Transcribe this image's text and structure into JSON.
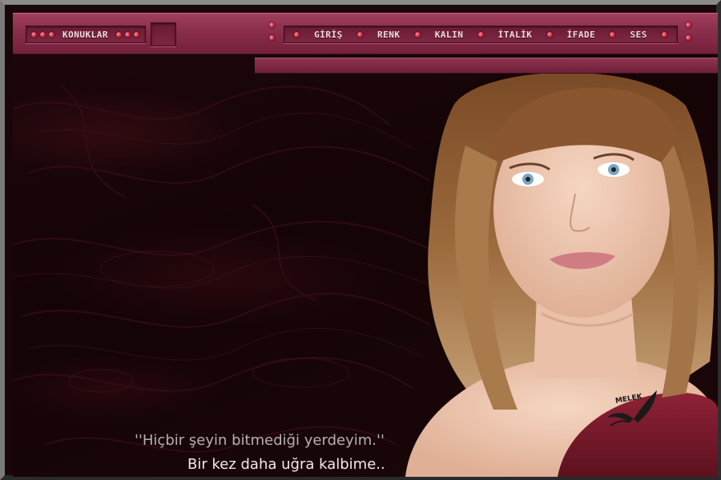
{
  "menu": {
    "topics_label": "KONUKLAR",
    "nav_items": [
      {
        "label": "GİRİŞ"
      },
      {
        "label": "RENK"
      },
      {
        "label": "KALIN"
      },
      {
        "label": "İTALİK"
      },
      {
        "label": "İFADE"
      },
      {
        "label": "SES"
      }
    ]
  },
  "quote": {
    "line1": "''Hiçbir şeyin bitmediği yerdeyim.''",
    "line2": "Bir kez daha uğra kalbime.."
  },
  "signature": "MELEK",
  "colors": {
    "accent": "#8b2f4c",
    "panel": "#6a1b33",
    "background": "#1a0608"
  },
  "icons": {
    "indicator": "red-dot-icon",
    "signature_mark": "angel-wings-icon"
  }
}
